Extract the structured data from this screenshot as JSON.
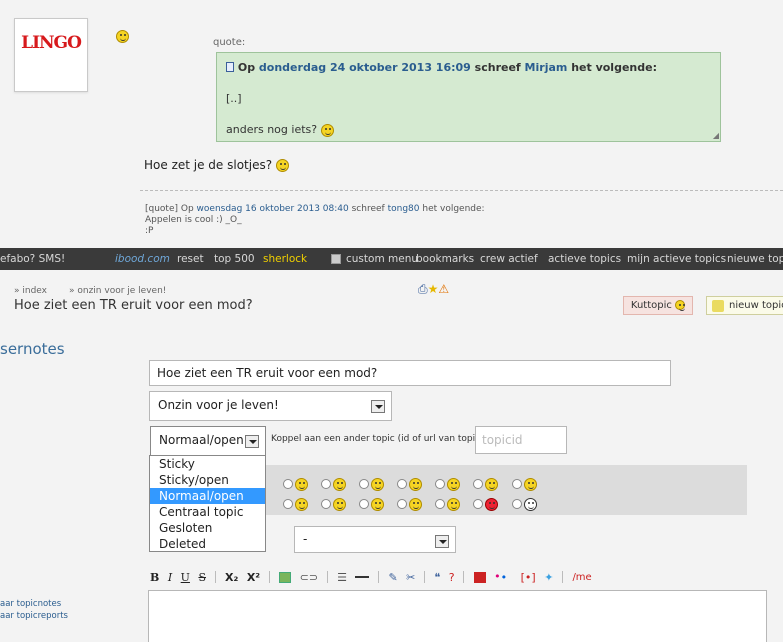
{
  "post": {
    "avatar_logo": "LINGO",
    "quote": {
      "label": "quote:",
      "prefix": "Op",
      "date": "donderdag 24 oktober 2013 16:09",
      "schreef": "schreef",
      "author": "Mirjam",
      "suffix": "het volgende:",
      "line1": "[..]",
      "line2": "anders nog iets?"
    },
    "text": "Hoe zet je de slotjes?",
    "signature": {
      "line1_prefix": "[quote] Op",
      "line1_date": "woensdag 16 oktober 2013 08:40",
      "line1_mid": "schreef",
      "line1_author": "tong80",
      "line1_suffix": "het volgende:",
      "line2": "Appelen is cool :) _O_",
      "line3": ":P"
    }
  },
  "navbar": {
    "items": [
      "efabo? SMS!",
      "ibood.com",
      "reset",
      "top 500",
      "sherlock",
      "custom menu",
      "bookmarks",
      "crew actief",
      "actieve topics",
      "mijn actieve topics",
      "nieuwe topi"
    ]
  },
  "breadcrumb": {
    "index": "» index",
    "forum": "» onzin voor je leven!"
  },
  "topic": {
    "title": "Hoe ziet een TR eruit voor een mod?",
    "kuttopic": "Kuttopic",
    "new_topic": "nieuw topic"
  },
  "section_title": "sernotes",
  "form": {
    "title_value": "Hoe ziet een TR eruit voor een mod?",
    "forum_value": "Onzin voor je leven!",
    "status_value": "Normaal/open",
    "koppel_label": "Koppel aan een ander topic (id of url van topic):",
    "topicid_placeholder": "topicid",
    "status_options": [
      "Sticky",
      "Sticky/open",
      "Normaal/open",
      "Centraal topic",
      "Gesloten",
      "Deleted"
    ],
    "dash_value": "-"
  },
  "editor_toolbar": {
    "bold": "B",
    "italic": "I",
    "underline": "U",
    "strike": "S",
    "sub": "X₂",
    "sup": "X²",
    "me": "/me"
  },
  "sidelinks": [
    "aar topicnotes",
    "aar topicreports"
  ]
}
